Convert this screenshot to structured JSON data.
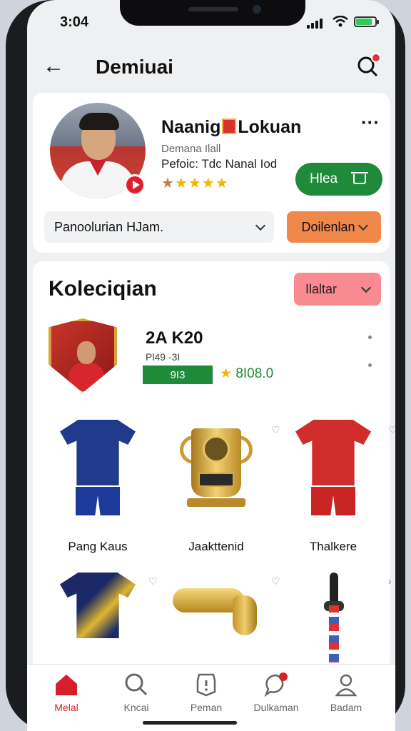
{
  "status": {
    "time": "3:04"
  },
  "appbar": {
    "title": "Demiuai"
  },
  "profile": {
    "name_part1": "Naanig",
    "name_part2": "Lokuan",
    "subtitle": "Demana Ilall",
    "position": "Pefoic: Tdc Nanal Iod",
    "stars": 5,
    "follow_label": "Hlea",
    "select_left": "Panoolurian HJam.",
    "select_right": "Doilenlan"
  },
  "collection": {
    "title": "Koleciqian",
    "filter_label": "Ilaltar",
    "featured": {
      "label": "2A K20",
      "date": "Pl49 -3I",
      "tag": "9I3",
      "rating": "8I08.0"
    },
    "items": [
      {
        "label": "Pang Kaus"
      },
      {
        "label": "Jaakttenid"
      },
      {
        "label": "Thalkere"
      }
    ]
  },
  "tabs": [
    {
      "label": "Melal",
      "icon": "home-icon",
      "active": true
    },
    {
      "label": "Kncai",
      "icon": "search-icon",
      "active": false
    },
    {
      "label": "Peman",
      "icon": "shield-icon",
      "active": false
    },
    {
      "label": "Dulkaman",
      "icon": "chat-icon",
      "active": false
    },
    {
      "label": "Badam",
      "icon": "profile-icon",
      "active": false
    }
  ],
  "colors": {
    "accent_red": "#d51f2a",
    "follow_green": "#1e8a3a",
    "select_orange": "#f0884a",
    "filter_pink": "#f98a90"
  }
}
